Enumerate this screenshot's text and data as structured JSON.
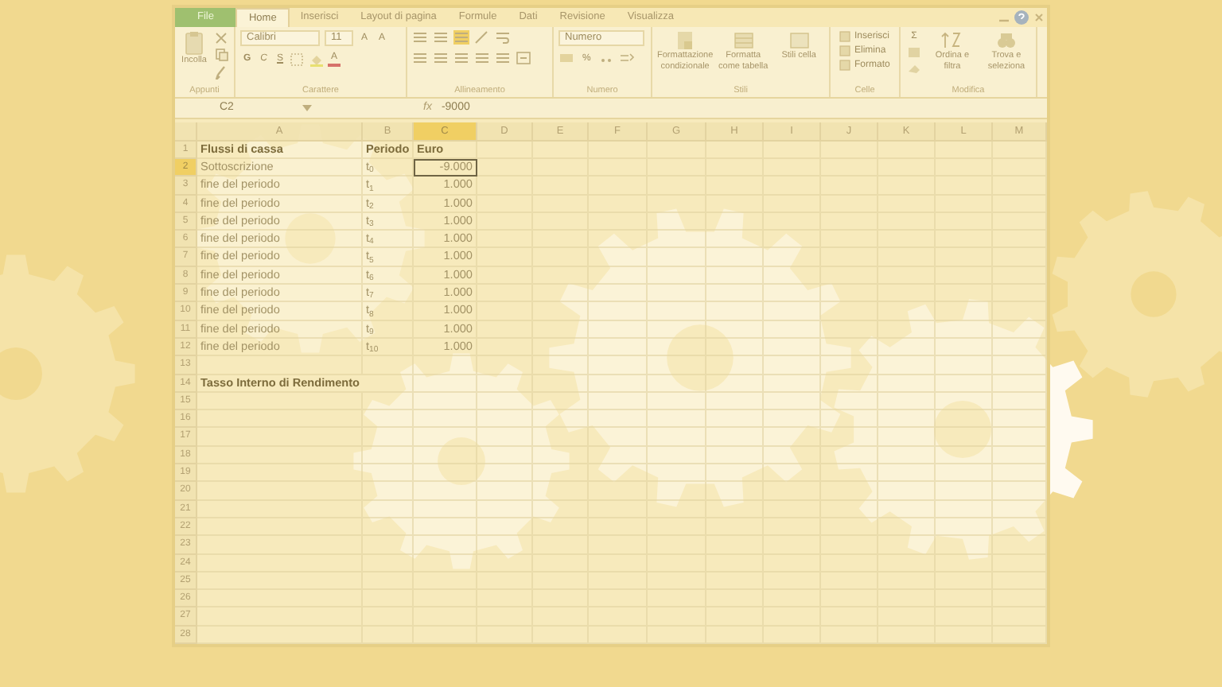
{
  "ribbon": {
    "tabs": [
      {
        "label": "File",
        "kind": "file",
        "selected": false
      },
      {
        "label": "Home",
        "kind": "tab",
        "selected": true
      },
      {
        "label": "Inserisci",
        "kind": "tab",
        "selected": false
      },
      {
        "label": "Layout di pagina",
        "kind": "tab",
        "selected": false
      },
      {
        "label": "Formule",
        "kind": "tab",
        "selected": false
      },
      {
        "label": "Dati",
        "kind": "tab",
        "selected": false
      },
      {
        "label": "Revisione",
        "kind": "tab",
        "selected": false
      },
      {
        "label": "Visualizza",
        "kind": "tab",
        "selected": false
      }
    ],
    "clipboard": {
      "paste": "Incolla",
      "label": "Appunti"
    },
    "font": {
      "name": "Calibri",
      "size": "11",
      "grow": "A",
      "shrink": "A",
      "bold": "G",
      "italic": "C",
      "underline": "S",
      "color_letter": "A",
      "label": "Carattere"
    },
    "alignment": {
      "label": "Allineamento"
    },
    "number": {
      "format": "Numero",
      "percent": "%",
      "label": "Numero"
    },
    "styles": {
      "buttons": [
        "Formattazione condizionale",
        "Formatta come tabella",
        "Stili cella"
      ],
      "label": "Stili"
    },
    "cells": {
      "buttons": [
        "Inserisci",
        "Elimina",
        "Formato"
      ],
      "label": "Celle"
    },
    "editing": {
      "sum": "Σ",
      "buttons": [
        "Ordina e filtra",
        "Trova e seleziona"
      ],
      "label": "Modifica"
    }
  },
  "formula_bar": {
    "name_box": "C2",
    "fx": "fx",
    "value": "-9000"
  },
  "sheet": {
    "columns": [
      {
        "label": "A",
        "selected": false
      },
      {
        "label": "B",
        "selected": false
      },
      {
        "label": "C",
        "selected": true
      },
      {
        "label": "D",
        "selected": false
      },
      {
        "label": "E",
        "selected": false
      },
      {
        "label": "F",
        "selected": false
      },
      {
        "label": "G",
        "selected": false
      },
      {
        "label": "H",
        "selected": false
      },
      {
        "label": "I",
        "selected": false
      },
      {
        "label": "J",
        "selected": false
      },
      {
        "label": "K",
        "selected": false
      },
      {
        "label": "L",
        "selected": false
      },
      {
        "label": "M",
        "selected": false
      }
    ],
    "rows": [
      {
        "number": "1",
        "selected": false,
        "bold": true,
        "cells": [
          "Flussi di cassa",
          "Periodo",
          "Euro"
        ]
      },
      {
        "number": "2",
        "selected": true,
        "bold": false,
        "cells": [
          "Sottoscrizione",
          "t$_{0}$",
          "-9.000"
        ]
      },
      {
        "number": "3",
        "selected": false,
        "bold": false,
        "cells": [
          "fine del periodo",
          "t$_{1}$",
          "1.000"
        ]
      },
      {
        "number": "4",
        "selected": false,
        "bold": false,
        "cells": [
          "fine del periodo",
          "t$_{2}$",
          "1.000"
        ]
      },
      {
        "number": "5",
        "selected": false,
        "bold": false,
        "cells": [
          "fine del periodo",
          "t$_{3}$",
          "1.000"
        ]
      },
      {
        "number": "6",
        "selected": false,
        "bold": false,
        "cells": [
          "fine del periodo",
          "t$_{4}$",
          "1.000"
        ]
      },
      {
        "number": "7",
        "selected": false,
        "bold": false,
        "cells": [
          "fine del periodo",
          "t$_{5}$",
          "1.000"
        ]
      },
      {
        "number": "8",
        "selected": false,
        "bold": false,
        "cells": [
          "fine del periodo",
          "t$_{6}$",
          "1.000"
        ]
      },
      {
        "number": "9",
        "selected": false,
        "bold": false,
        "cells": [
          "fine del periodo",
          "t$_{7}$",
          "1.000"
        ]
      },
      {
        "number": "10",
        "selected": false,
        "bold": false,
        "cells": [
          "fine del periodo",
          "t$_{8}$",
          "1.000"
        ]
      },
      {
        "number": "11",
        "selected": false,
        "bold": false,
        "cells": [
          "fine del periodo",
          "t$_{9}$",
          "1.000"
        ]
      },
      {
        "number": "12",
        "selected": false,
        "bold": false,
        "cells": [
          "fine del periodo",
          "t$_{10}$",
          "1.000"
        ]
      },
      {
        "number": "13",
        "selected": false
      },
      {
        "number": "14",
        "selected": false,
        "bold": true,
        "cells": [
          "Tasso Interno di Rendimento"
        ]
      },
      {
        "number": "15",
        "selected": false
      },
      {
        "number": "16",
        "selected": false
      },
      {
        "number": "17",
        "selected": false
      },
      {
        "number": "18",
        "selected": false
      },
      {
        "number": "19",
        "selected": false
      },
      {
        "number": "20",
        "selected": false
      },
      {
        "number": "21",
        "selected": false
      },
      {
        "number": "22",
        "selected": false
      },
      {
        "number": "23",
        "selected": false
      },
      {
        "number": "24",
        "selected": false
      },
      {
        "number": "25",
        "selected": false
      },
      {
        "number": "26",
        "selected": false
      },
      {
        "number": "27",
        "selected": false
      },
      {
        "number": "28",
        "selected": false
      }
    ]
  }
}
